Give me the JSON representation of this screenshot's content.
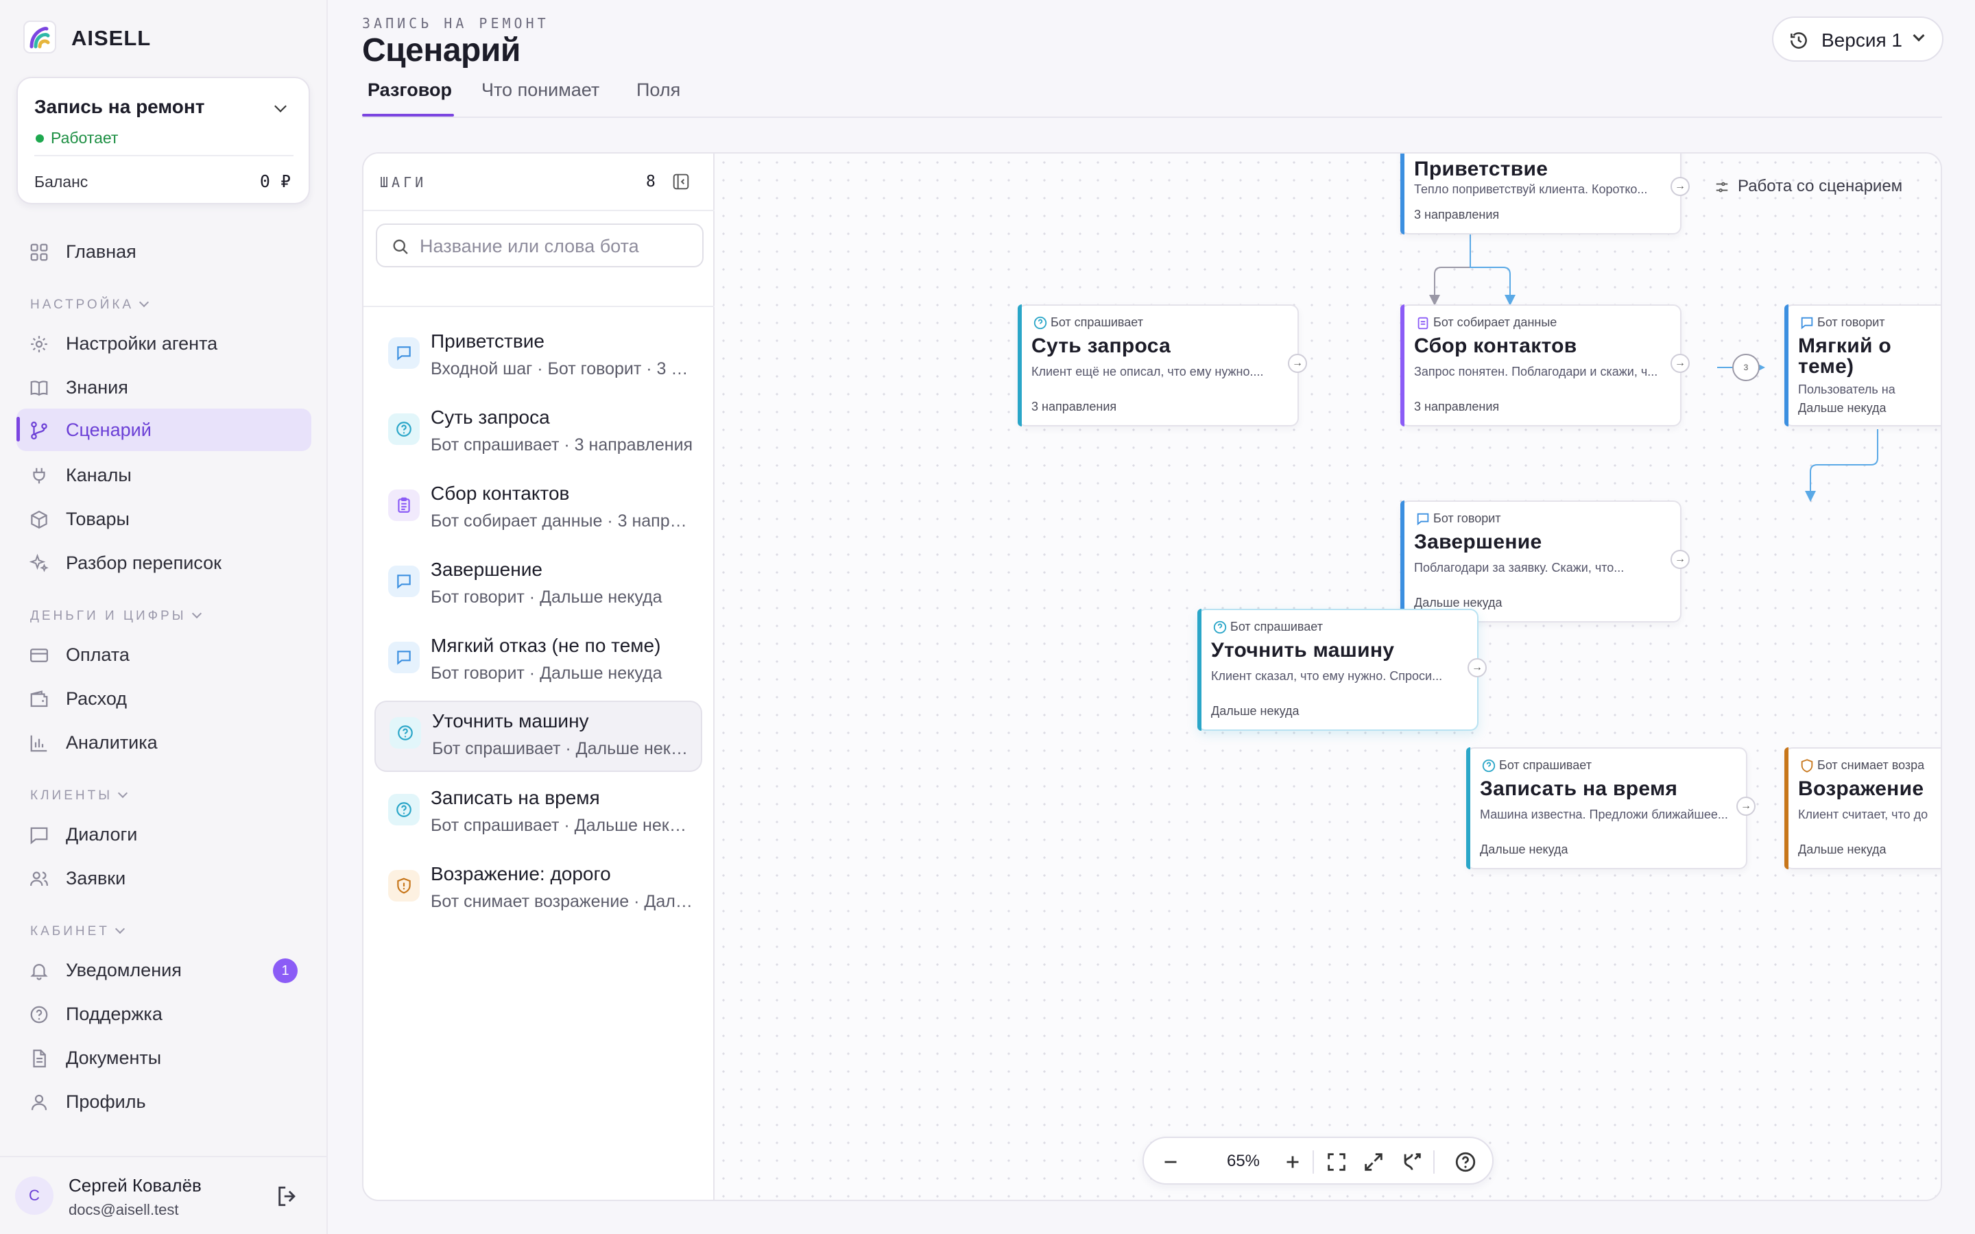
{
  "app": {
    "name": "AISELL"
  },
  "project": {
    "name": "Запись на ремонт",
    "status": "Работает",
    "balance_label": "Баланс",
    "balance_value": "0 ₽",
    "status_color": "#1ea84f"
  },
  "nav": {
    "main": {
      "label": "Главная",
      "icon": "dashboard-icon"
    },
    "sections": {
      "settings": "НАСТРОЙКА",
      "money": "ДЕНЬГИ И ЦИФРЫ",
      "clients": "КЛИЕНТЫ",
      "cabinet": "КАБИНЕТ"
    },
    "items": [
      {
        "label": "Настройки агента",
        "icon": "gear-icon"
      },
      {
        "label": "Знания",
        "icon": "book-icon"
      },
      {
        "label": "Сценарий",
        "icon": "branch-icon",
        "active": true
      },
      {
        "label": "Каналы",
        "icon": "plug-icon"
      },
      {
        "label": "Товары",
        "icon": "box-icon"
      },
      {
        "label": "Разбор переписок",
        "icon": "sparkle-icon"
      },
      {
        "label": "Оплата",
        "icon": "card-icon"
      },
      {
        "label": "Расход",
        "icon": "wallet-icon"
      },
      {
        "label": "Аналитика",
        "icon": "chart-icon"
      },
      {
        "label": "Диалоги",
        "icon": "chat-icon"
      },
      {
        "label": "Заявки",
        "icon": "users-icon"
      },
      {
        "label": "Уведомления",
        "icon": "bell-icon",
        "badge": "1"
      },
      {
        "label": "Поддержка",
        "icon": "help-icon"
      },
      {
        "label": "Документы",
        "icon": "document-icon"
      },
      {
        "label": "Профиль",
        "icon": "user-icon"
      }
    ]
  },
  "user": {
    "initial": "С",
    "name": "Сергей Ковалёв",
    "email": "docs@aisell.test"
  },
  "header": {
    "eyebrow": "ЗАПИСЬ НА РЕМОНТ",
    "title": "Сценарий",
    "tabs": [
      "Разговор",
      "Что понимает",
      "Поля"
    ],
    "active_tab": "Разговор",
    "version": "Версия 1",
    "accent": "#7b45e0"
  },
  "steps": {
    "title": "ШАГИ",
    "count": "8",
    "search_placeholder": "Название или слова бота",
    "items": [
      {
        "title": "Приветствие",
        "subtitle": "Входной шаг · Бот говорит · 3 направления",
        "kind": "say"
      },
      {
        "title": "Суть запроса",
        "subtitle": "Бот спрашивает · 3 направления",
        "kind": "ask"
      },
      {
        "title": "Сбор контактов",
        "subtitle": "Бот собирает данные · 3 направления",
        "kind": "collect"
      },
      {
        "title": "Завершение",
        "subtitle": "Бот говорит · Дальше некуда",
        "kind": "say"
      },
      {
        "title": "Мягкий отказ (не по теме)",
        "subtitle": "Бот говорит · Дальше некуда",
        "kind": "say"
      },
      {
        "title": "Уточнить машину",
        "subtitle": "Бот спрашивает · Дальше некуда",
        "kind": "ask",
        "selected": true
      },
      {
        "title": "Записать на время",
        "subtitle": "Бот спрашивает · Дальше некуда",
        "kind": "ask"
      },
      {
        "title": "Возражение: дорого",
        "subtitle": "Бот снимает возражение · Дальше некуда",
        "kind": "objection"
      }
    ]
  },
  "canvas": {
    "work_label": "Работа со сценарием",
    "zoom": "65%",
    "merge_count": "3",
    "nodes": [
      {
        "id": "greet",
        "type": "",
        "title": "Приветствие",
        "desc": "Тепло поприветствуй клиента. Коротко...",
        "foot": "3 направления",
        "kind": "say"
      },
      {
        "id": "essence",
        "type": "Бот спрашивает",
        "title": "Суть запроса",
        "desc": "Клиент ещё не описал, что ему нужно....",
        "foot": "3 направления",
        "kind": "ask"
      },
      {
        "id": "contacts",
        "type": "Бот собирает данные",
        "title": "Сбор контактов",
        "desc": "Запрос понятен. Поблагодари и скажи, ч...",
        "foot": "3 направления",
        "kind": "collect"
      },
      {
        "id": "soft",
        "type": "Бот говорит",
        "title": "Мягкий о",
        "title2": "теме)",
        "desc": "Пользователь на",
        "foot": "Дальше некуда",
        "kind": "say"
      },
      {
        "id": "finish",
        "type": "Бот говорит",
        "title": "Завершение",
        "desc": "Поблагодари за заявку. Скажи, что...",
        "foot": "Дальше некуда",
        "kind": "say"
      },
      {
        "id": "car",
        "type": "Бот спрашивает",
        "title": "Уточнить машину",
        "desc": "Клиент сказал, что ему нужно. Спроси...",
        "foot": "Дальше некуда",
        "kind": "ask"
      },
      {
        "id": "time",
        "type": "Бот спрашивает",
        "title": "Записать на время",
        "desc": "Машина известна. Предложи ближайшее...",
        "foot": "Дальше некуда",
        "kind": "ask"
      },
      {
        "id": "objection",
        "type": "Бот снимает возра",
        "title": "Возражение",
        "desc": "Клиент считает, что до",
        "foot": "Дальше некуда",
        "kind": "objection"
      }
    ]
  }
}
